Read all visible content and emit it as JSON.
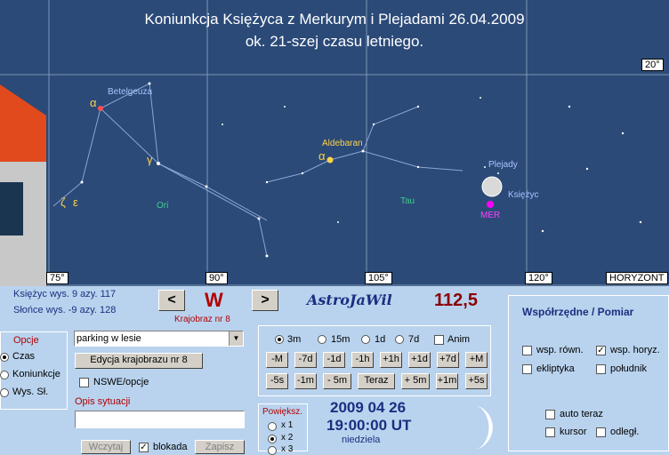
{
  "sky": {
    "title_line1": "Koniunkcja Księżyca z Merkurym i Plejadami  26.04.2009",
    "title_line2": "ok. 21-szej czasu letniego.",
    "alt_label": "20°",
    "horizon_label": "HORYZONT",
    "azimuth_ticks": [
      "75°",
      "90°",
      "105°",
      "120°"
    ],
    "objects": {
      "betelgeuse": "Betelgeuza",
      "betelgeuse_greek": "α",
      "gamma_greek": "γ",
      "zeta_greek": "ζ",
      "epsilon_greek": "ε",
      "ori": "Ori",
      "aldebaran": "Aldebaran",
      "aldebaran_greek": "α",
      "tau": "Tau",
      "pleiades": "Plejady",
      "moon": "Księżyc",
      "mercury": "MER"
    },
    "colors": {
      "sky": "#2b4a78",
      "grid": "#7f95b5",
      "constellation": "#8aa6d4"
    }
  },
  "info": {
    "moon_alt": "Księżyc wys. 9    azy. 117",
    "sun_alt": "Słońce wys. -9    azy. 128",
    "direction": "W",
    "landscape_no": "Krajobraz nr 8",
    "app_name": "AstroJaWil",
    "azimuth_value": "112,5",
    "prev_button": "<",
    "next_button": ">"
  },
  "options": {
    "group_label": "Opcje",
    "items": [
      "Czas",
      "Koniunkcje",
      "Wys. Sł."
    ],
    "selected": "Czas"
  },
  "landscape": {
    "select_value": "parking w lesie",
    "edit_button": "Edycja krajobrazu nr 8",
    "nswe_label": "NSWE/opcje",
    "situation_label": "Opis sytuacji",
    "situation_value": "",
    "load_button": "Wczytaj",
    "lock_label": "blokada",
    "save_button": "Zapisz"
  },
  "time_step": {
    "radios": [
      "3m",
      "15m",
      "1d",
      "7d"
    ],
    "selected": "3m",
    "anim_label": "Anim",
    "row1": [
      "-M",
      "-7d",
      "-1d",
      "-1h",
      "+1h",
      "+1d",
      "+7d",
      "+M"
    ],
    "row2": [
      "-5s",
      "-1m",
      "- 5m",
      "Teraz",
      "+ 5m",
      "+1m",
      "+5s"
    ]
  },
  "zoom": {
    "label": "Powiększ.",
    "options": [
      "x 1",
      "x 2",
      "x 3"
    ],
    "selected": "x 2"
  },
  "datetime": {
    "date": "2009 04 26",
    "time": "19:00:00 UT",
    "weekday": "niedziela"
  },
  "coords": {
    "title": "Współrzędne / Pomiar",
    "items": [
      {
        "label": "wsp. równ.",
        "checked": false
      },
      {
        "label": "wsp. horyz.",
        "checked": true
      },
      {
        "label": "ekliptyka",
        "checked": false
      },
      {
        "label": "południk",
        "checked": false
      },
      {
        "label": "auto teraz",
        "checked": false
      },
      {
        "label": "kursor",
        "checked": false
      },
      {
        "label": "odległ.",
        "checked": false
      }
    ]
  }
}
